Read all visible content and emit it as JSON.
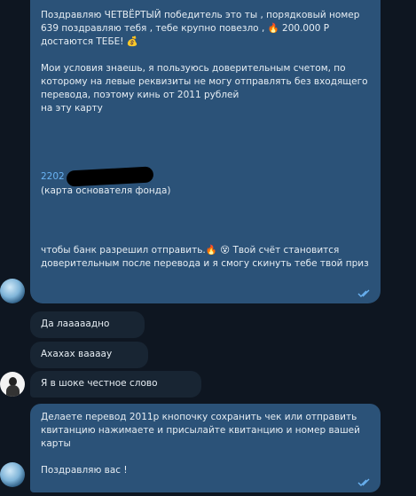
{
  "messages": {
    "m1": {
      "text": "Поздравляю ЧЕТВЁРТЫЙ победитель это ты , порядковый номер 639 поздравляю тебя , тебе крупно повезло , 🔥 200.000 Р достаются ТЕБЕ! 💰\n\nМои условия знаешь, я пользуюсь доверительным счетом, по которому на левые реквизиты не могу отправлять без входящего перевода, поэтому кинь от 2011 рублей\nна эту карту",
      "card_prefix": "2202",
      "card_caption": "(карта основателя фонда)",
      "closing": "чтобы банк разрешил отправить.🔥 😵 Твой счёт становится доверительным после перевода и я смогу скинуть тебе твой приз"
    },
    "m2": {
      "text": "Да лааааадно"
    },
    "m3": {
      "text": "Ахахах ваааау"
    },
    "m4": {
      "text": "Я в шоке честное слово"
    },
    "m5": {
      "text": "Делаете перевод 2011р кнопочку сохранить чек или отправить квитанцию нажимаете и присылайте квитанцию и номер вашей карты\n\nПоздравляю вас !"
    }
  },
  "colors": {
    "background": "#0e1621",
    "outgoing": "#2b5278",
    "incoming": "#182533",
    "link": "#6ab3f3",
    "check": "#6ab3f3"
  }
}
